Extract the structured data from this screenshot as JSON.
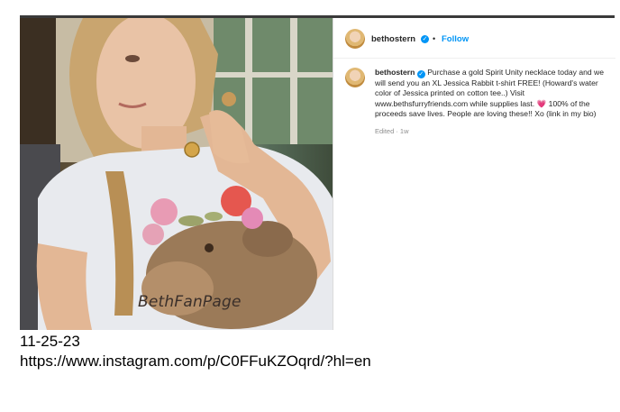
{
  "post": {
    "username": "bethostern",
    "follow_label": "Follow",
    "separator": "•",
    "caption_text": "Purchase a gold Spirit Unity necklace today and we will send you an XL Jessica Rabbit t-shirt FREE! (Howard's water color of Jessica printed on cotton tee..) Visit www.bethsfurryfriends.com while supplies last. 💗 100% of the proceeds save lives. People are loving these!! Xo (link in my bio)",
    "meta_edited": "Edited · 1w",
    "photo_watermark": "BethFanPage",
    "verified_icon": "verified-badge-icon",
    "verified_color": "#0095f6",
    "follow_color": "#0095f6"
  },
  "annotations": {
    "date": "11-25-23",
    "url": "https://www.instagram.com/p/C0FFuKZOqrd/?hl=en"
  }
}
